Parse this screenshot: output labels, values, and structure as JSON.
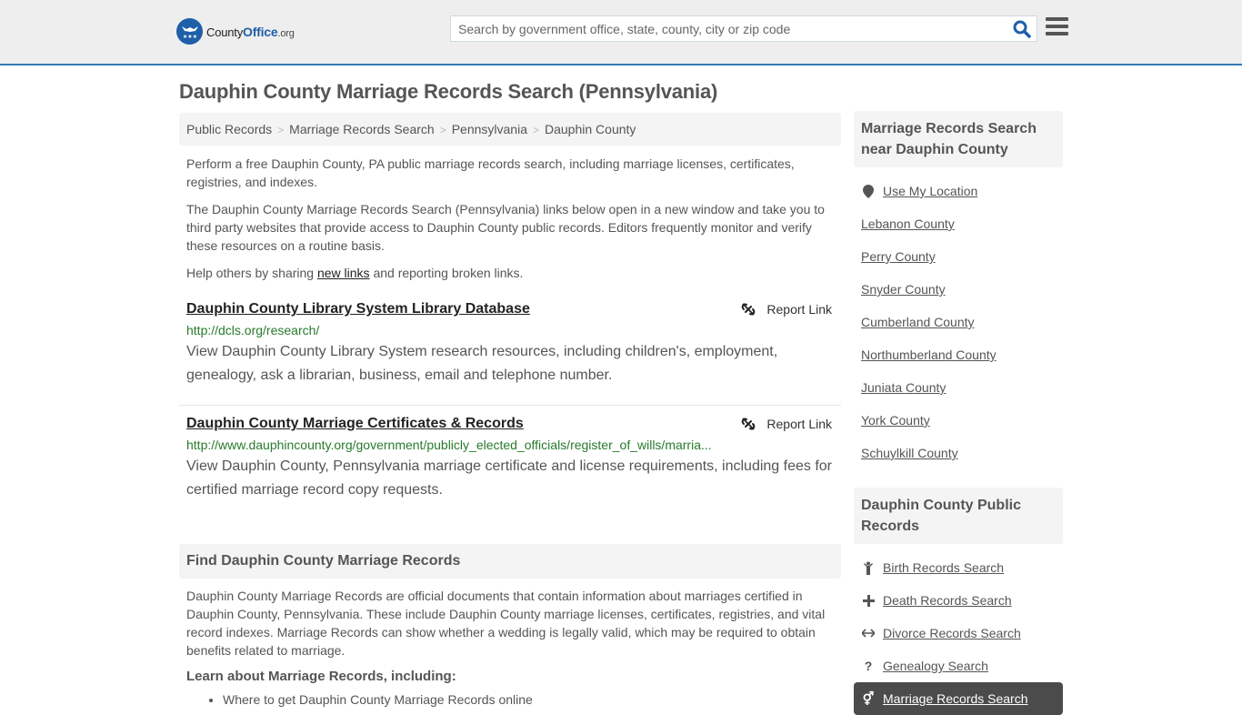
{
  "header": {
    "logo": {
      "name": "County",
      "brand": "Office",
      "tld": ".org"
    },
    "search_placeholder": "Search by government office, state, county, city or zip code",
    "search_value": ""
  },
  "page_title": "Dauphin County Marriage Records Search (Pennsylvania)",
  "breadcrumb": [
    "Public Records",
    "Marriage Records Search",
    "Pennsylvania",
    "Dauphin County"
  ],
  "intro": {
    "p1": "Perform a free Dauphin County, PA public marriage records search, including marriage licenses, certificates, registries, and indexes.",
    "p2": "The Dauphin County Marriage Records Search (Pennsylvania) links below open in a new window and take you to third party websites that provide access to Dauphin County public records. Editors frequently monitor and verify these resources on a routine basis.",
    "p3_before": "Help others by sharing ",
    "p3_link": "new links",
    "p3_after": " and reporting broken links."
  },
  "results": [
    {
      "title": "Dauphin County Library System Library Database",
      "url": "http://dcls.org/research/",
      "description": "View Dauphin County Library System research resources, including children's, employment, genealogy, ask a librarian, business, email and telephone number.",
      "report_label": "Report Link"
    },
    {
      "title": "Dauphin County Marriage Certificates & Records",
      "url": "http://www.dauphincounty.org/government/publicly_elected_officials/register_of_wills/marria...",
      "description": "View Dauphin County, Pennsylvania marriage certificate and license requirements, including fees for certified marriage record copy requests.",
      "report_label": "Report Link"
    }
  ],
  "find_section": {
    "heading": "Find Dauphin County Marriage Records",
    "paragraph": "Dauphin County Marriage Records are official documents that contain information about marriages certified in Dauphin County, Pennsylvania. These include Dauphin County marriage licenses, certificates, registries, and vital record indexes. Marriage Records can show whether a wedding is legally valid, which may be required to obtain benefits related to marriage.",
    "subheading": "Learn about Marriage Records, including:",
    "bullets": [
      "Where to get Dauphin County Marriage Records online"
    ]
  },
  "sidebar": {
    "nearby": {
      "heading": "Marriage Records Search near Dauphin County",
      "use_location": "Use My Location",
      "counties": [
        "Lebanon County",
        "Perry County",
        "Snyder County",
        "Cumberland County",
        "Northumberland County",
        "Juniata County",
        "York County",
        "Schuylkill County"
      ]
    },
    "public_records": {
      "heading": "Dauphin County Public Records",
      "items": [
        {
          "label": "Birth Records Search",
          "icon": "child-icon"
        },
        {
          "label": "Death Records Search",
          "icon": "plus-icon"
        },
        {
          "label": "Divorce Records Search",
          "icon": "arrows-horizontal-icon"
        },
        {
          "label": "Genealogy Search",
          "icon": "question-icon"
        },
        {
          "label": "Marriage Records Search",
          "icon": "venus-mars-icon",
          "active": true
        }
      ]
    }
  },
  "colors": {
    "brand_blue": "#1e5fa8",
    "header_border": "#337ab7",
    "url_green": "#287b2c",
    "active_item_bg": "#4b4b4b"
  }
}
